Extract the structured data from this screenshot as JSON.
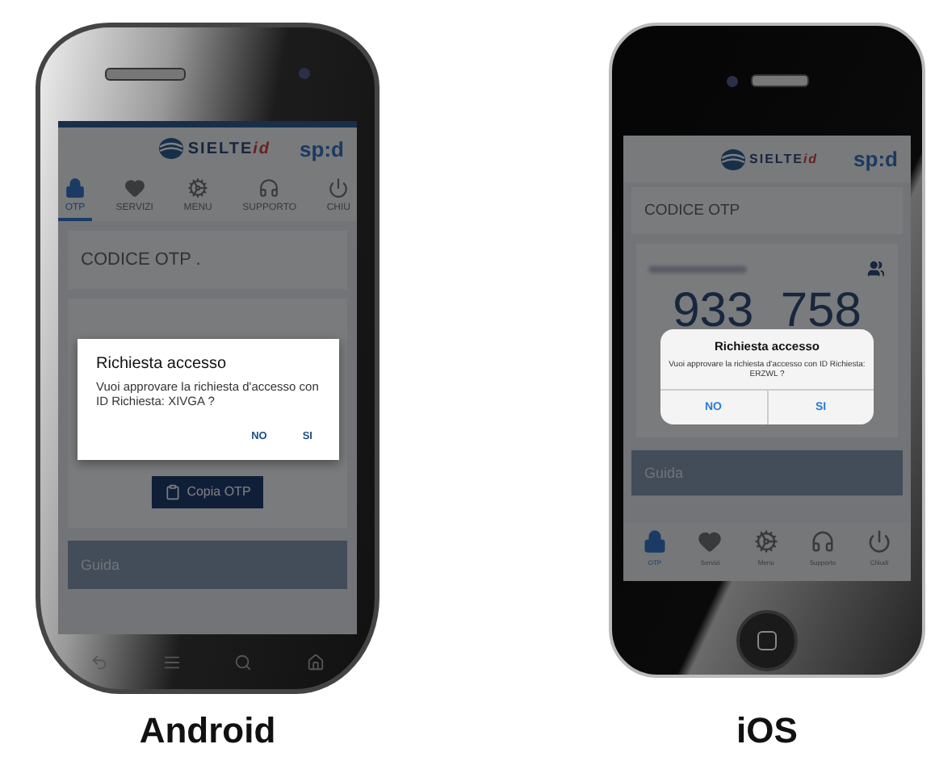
{
  "phones": [
    {
      "kind": "android",
      "caption": "Android",
      "logo": "SIELTE",
      "logo_suffix": "id",
      "spid": "sp:d",
      "tabs": [
        {
          "label": "OTP",
          "selected": true
        },
        {
          "label": "SERVIZI",
          "selected": false
        },
        {
          "label": "MENU",
          "selected": false
        },
        {
          "label": "SUPPORTO",
          "selected": false
        },
        {
          "label": "CHIU",
          "selected": false
        }
      ],
      "title": "CODICE OTP .",
      "copy_button": "Copia OTP",
      "guide": "Guida",
      "dialog": {
        "title": "Richiesta accesso",
        "message": "Vuoi approvare la richiesta d'accesso con ID Richiesta: XIVGA ?",
        "buttons": [
          "NO",
          "SI"
        ]
      }
    },
    {
      "kind": "ios",
      "caption": "iOS",
      "logo": "SIELTE",
      "logo_suffix": "id",
      "spid": "sp:d",
      "tabs": [
        {
          "label": "OTP",
          "selected": true
        },
        {
          "label": "Servizi",
          "selected": false
        },
        {
          "label": "Menu",
          "selected": false
        },
        {
          "label": "Supporto",
          "selected": false
        },
        {
          "label": "Chiudi",
          "selected": false
        }
      ],
      "title": "CODICE OTP",
      "otp": "933  758",
      "guide": "Guida",
      "dialog": {
        "title": "Richiesta accesso",
        "message": "Vuoi approvare la richiesta d'accesso con ID Richiesta: ERZWL ?",
        "buttons": [
          "NO",
          "SI"
        ]
      }
    }
  ]
}
